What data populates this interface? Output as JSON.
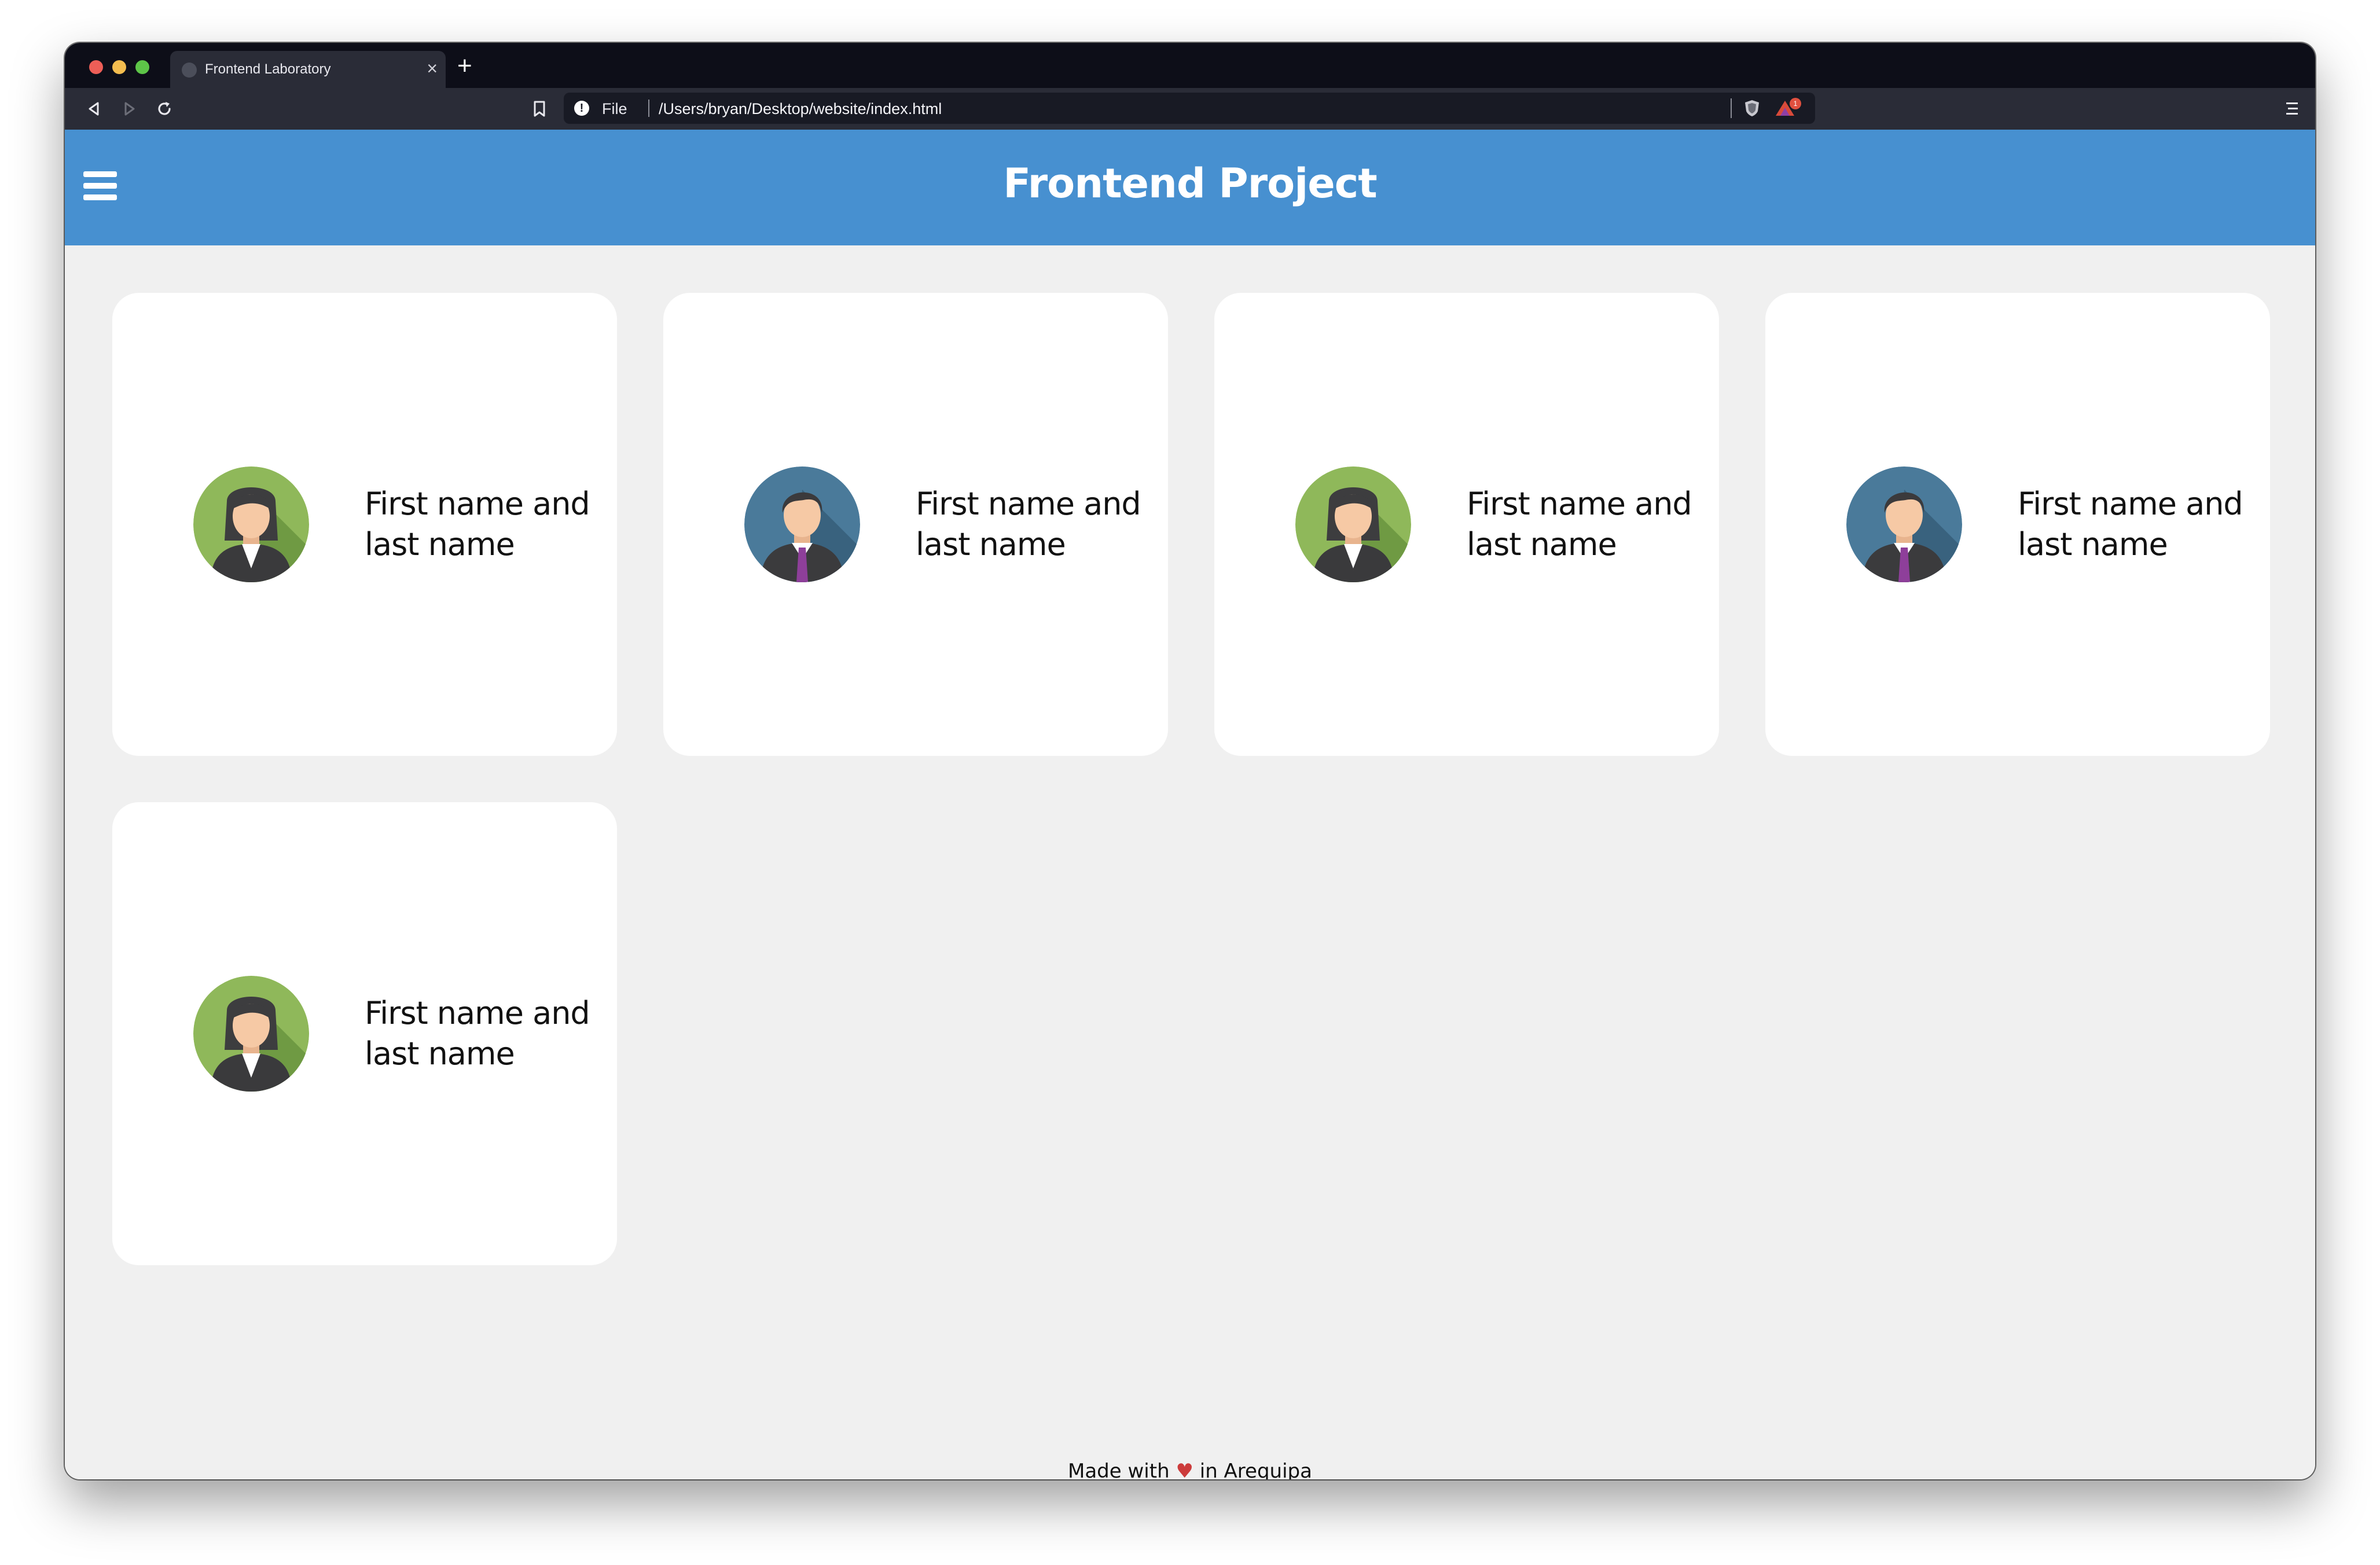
{
  "browser": {
    "tab_title": "Frontend Laboratory",
    "tab_close": "×",
    "new_tab": "+",
    "url_scheme": "File",
    "url": "/Users/bryan/Desktop/website/index.html",
    "rewards_badge": "1"
  },
  "app": {
    "title": "Frontend Project",
    "header_color": "#4790d0"
  },
  "cards": [
    {
      "name": "First name and last name",
      "avatar": "female-avatar-icon"
    },
    {
      "name": "First name and last name",
      "avatar": "male-avatar-icon"
    },
    {
      "name": "First name and last name",
      "avatar": "female-avatar-icon"
    },
    {
      "name": "First name and last name",
      "avatar": "male-avatar-icon"
    },
    {
      "name": "First name and last name",
      "avatar": "female-avatar-icon"
    }
  ],
  "footer": {
    "prefix": "Made with",
    "heart": "♥",
    "suffix": "in Arequipa"
  }
}
